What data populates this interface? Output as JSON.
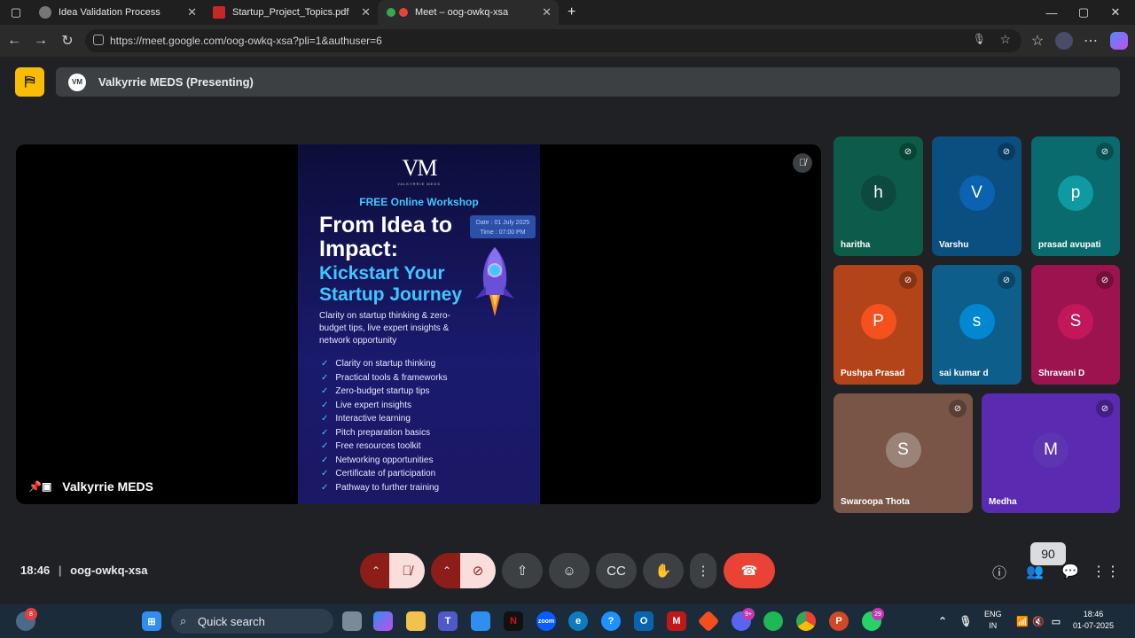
{
  "browser": {
    "tabs": [
      {
        "title": "Idea Validation Process",
        "active": false
      },
      {
        "title": "Startup_Project_Topics.pdf",
        "active": false
      },
      {
        "title": "Meet – oog-owkq-xsa",
        "active": true
      }
    ],
    "url": "https://meet.google.com/oog-owkq-xsa?pli=1&authuser=6"
  },
  "meet": {
    "banner": {
      "avatar_text": "VM",
      "label": "Valkyrrie MEDS (Presenting)"
    },
    "stage": {
      "presenter_name": "Valkyrrie MEDS"
    },
    "poster": {
      "logo": "VM",
      "logo_sub": "VALKYRRIE MEDS",
      "workshop": "FREE Online Workshop",
      "date": "Date : 01 July 2025",
      "time": "Time : 07:00 PM",
      "headline_1": "From Idea to",
      "headline_2": "Impact:",
      "subheadline_1": "Kickstart Your",
      "subheadline_2": "Startup Journey",
      "description": "Clarity on startup thinking & zero-budget tips, live expert insights & network opportunity",
      "items": [
        "Clarity on startup thinking",
        "Practical tools & frameworks",
        "Zero-budget startup tips",
        "Live expert insights",
        "Interactive learning",
        "Pitch preparation basics",
        "Free resources toolkit",
        "Networking opportunities",
        "Certificate of participation",
        "Pathway to further training"
      ]
    },
    "participants": [
      {
        "initial": "h",
        "name": "haritha",
        "bg": "#0d5c4a",
        "avatar_bg": "#0b4a3c"
      },
      {
        "initial": "V",
        "name": "Varshu",
        "bg": "#0b4f80",
        "avatar_bg": "#0a63b0"
      },
      {
        "initial": "p",
        "name": "prasad avupati",
        "bg": "#0a6b6e",
        "avatar_bg": "#0f9aa3"
      },
      {
        "initial": "P",
        "name": "Pushpa Prasad",
        "bg": "#b3441a",
        "avatar_bg": "#f4511e"
      },
      {
        "initial": "s",
        "name": "sai kumar d",
        "bg": "#0d5e8a",
        "avatar_bg": "#0288d1"
      },
      {
        "initial": "S",
        "name": "Shravani D",
        "bg": "#9c1350",
        "avatar_bg": "#c2185b"
      },
      {
        "initial": "S",
        "name": "Swaroopa Thota",
        "bg": "#795548",
        "avatar_bg": "#9a8378"
      },
      {
        "initial": "M",
        "name": "Medha",
        "bg": "#5a2ab0",
        "avatar_bg": "#5e35b1"
      }
    ],
    "time": "18:46",
    "meeting_code": "oog-owkq-xsa",
    "participant_count": "90"
  },
  "taskbar": {
    "weather_badge": "8",
    "search_placeholder": "Quick search",
    "discord_badge": "9+",
    "whatsapp_badge": "29",
    "lang_1": "ENG",
    "lang_2": "IN",
    "clock_time": "18:46",
    "clock_date": "01-07-2025"
  },
  "colors": {
    "meet_bg": "#202124",
    "control_dark": "#3c4043",
    "hangup": "#ea4335",
    "activity_yellow": "#fbbc04",
    "poster_accent": "#3ec8ff"
  }
}
